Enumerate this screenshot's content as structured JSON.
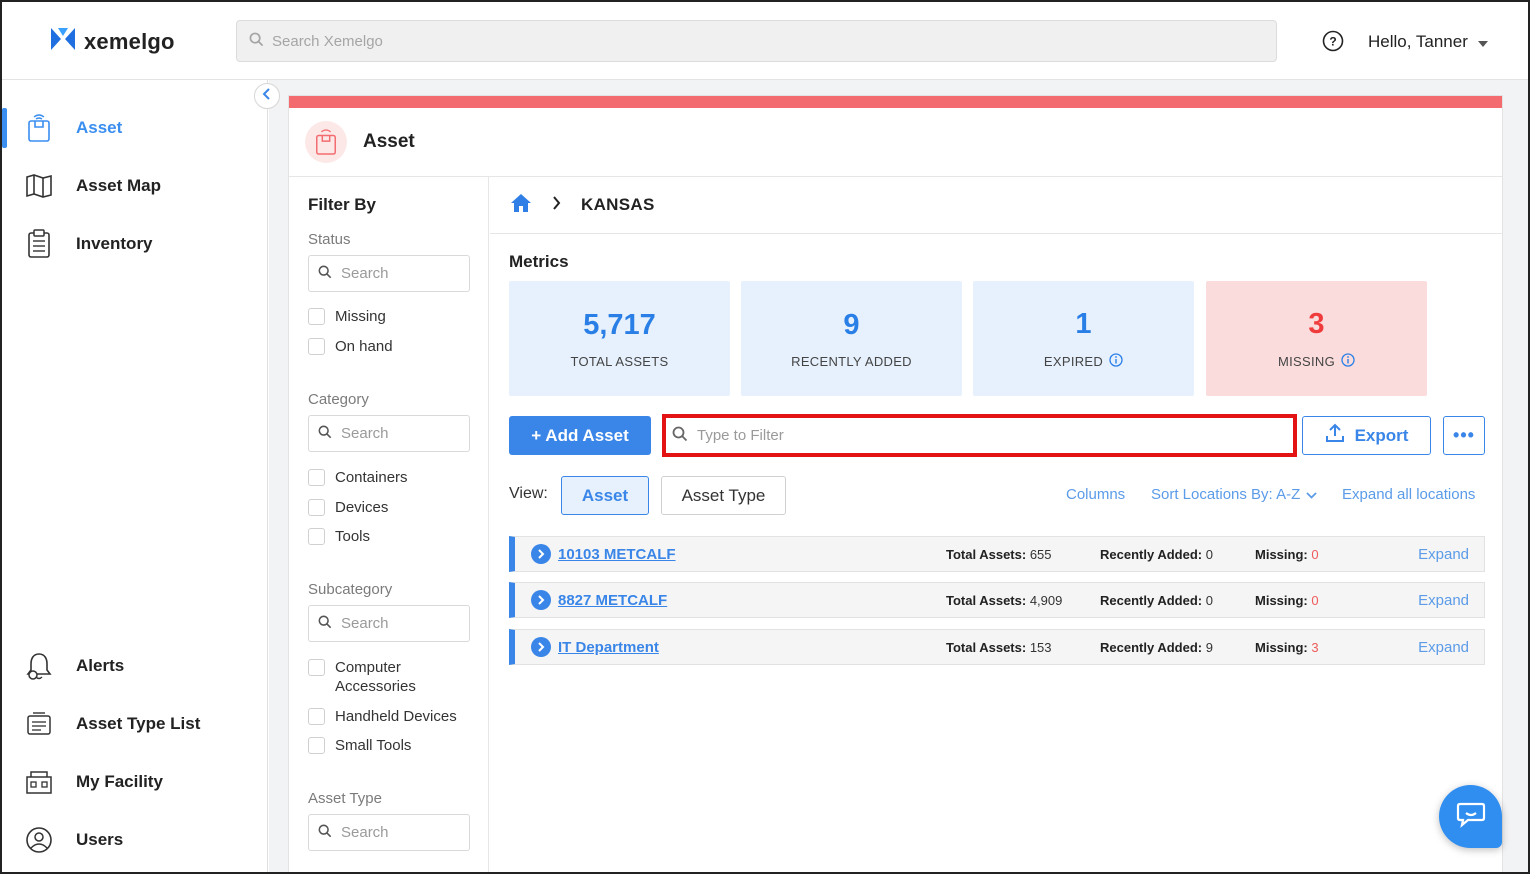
{
  "app": {
    "name": "xemelgo"
  },
  "header": {
    "search_placeholder": "Search Xemelgo",
    "greeting": "Hello, Tanner"
  },
  "sidebar": {
    "items": [
      {
        "label": "Asset",
        "icon": "asset-icon",
        "active": true
      },
      {
        "label": "Asset Map",
        "icon": "map-icon"
      },
      {
        "label": "Inventory",
        "icon": "inventory-icon"
      },
      {
        "label": "Alerts",
        "icon": "bell-icon"
      },
      {
        "label": "Asset Type List",
        "icon": "asset-type-list-icon"
      },
      {
        "label": "My Facility",
        "icon": "facility-icon"
      },
      {
        "label": "Users",
        "icon": "user-icon"
      }
    ]
  },
  "page": {
    "title": "Asset"
  },
  "filters": {
    "heading": "Filter By",
    "status": {
      "title": "Status",
      "search_placeholder": "Search",
      "options": [
        "Missing",
        "On hand"
      ]
    },
    "category": {
      "title": "Category",
      "search_placeholder": "Search",
      "options": [
        "Containers",
        "Devices",
        "Tools"
      ]
    },
    "subcategory": {
      "title": "Subcategory",
      "search_placeholder": "Search",
      "options": [
        "Computer Accessories",
        "Handheld Devices",
        "Small Tools"
      ]
    },
    "asset_type": {
      "title": "Asset Type",
      "search_placeholder": "Search"
    }
  },
  "breadcrumb": {
    "current": "KANSAS"
  },
  "metrics": {
    "title": "Metrics",
    "cards": [
      {
        "value": "5,717",
        "label": "TOTAL ASSETS",
        "info": false,
        "tone": "blue"
      },
      {
        "value": "9",
        "label": "RECENTLY ADDED",
        "info": false,
        "tone": "blue"
      },
      {
        "value": "1",
        "label": "EXPIRED",
        "info": true,
        "tone": "blue"
      },
      {
        "value": "3",
        "label": "MISSING",
        "info": true,
        "tone": "red"
      }
    ]
  },
  "toolbar": {
    "add_label": "+ Add Asset",
    "filter_placeholder": "Type to Filter",
    "export_label": "Export",
    "more_label": "•••"
  },
  "view": {
    "label": "View:",
    "tabs": [
      "Asset",
      "Asset Type"
    ],
    "columns_link": "Columns",
    "sort_link": "Sort Locations By: A-Z",
    "expand_all_link": "Expand all locations"
  },
  "locations": [
    {
      "name": "10103 METCALF",
      "total_label": "Total Assets:",
      "total": "655",
      "recent_label": "Recently Added:",
      "recent": "0",
      "missing_label": "Missing:",
      "missing": "0",
      "action": "Expand"
    },
    {
      "name": "8827 METCALF",
      "total_label": "Total Assets:",
      "total": "4,909",
      "recent_label": "Recently Added:",
      "recent": "0",
      "missing_label": "Missing:",
      "missing": "0",
      "action": "Expand"
    },
    {
      "name": "IT Department",
      "total_label": "Total Assets:",
      "total": "153",
      "recent_label": "Recently Added:",
      "recent": "9",
      "missing_label": "Missing:",
      "missing": "3",
      "action": "Expand"
    }
  ],
  "colors": {
    "accent": "#3a86e8",
    "alert": "#f36a6f",
    "highlight": "#e31313"
  }
}
